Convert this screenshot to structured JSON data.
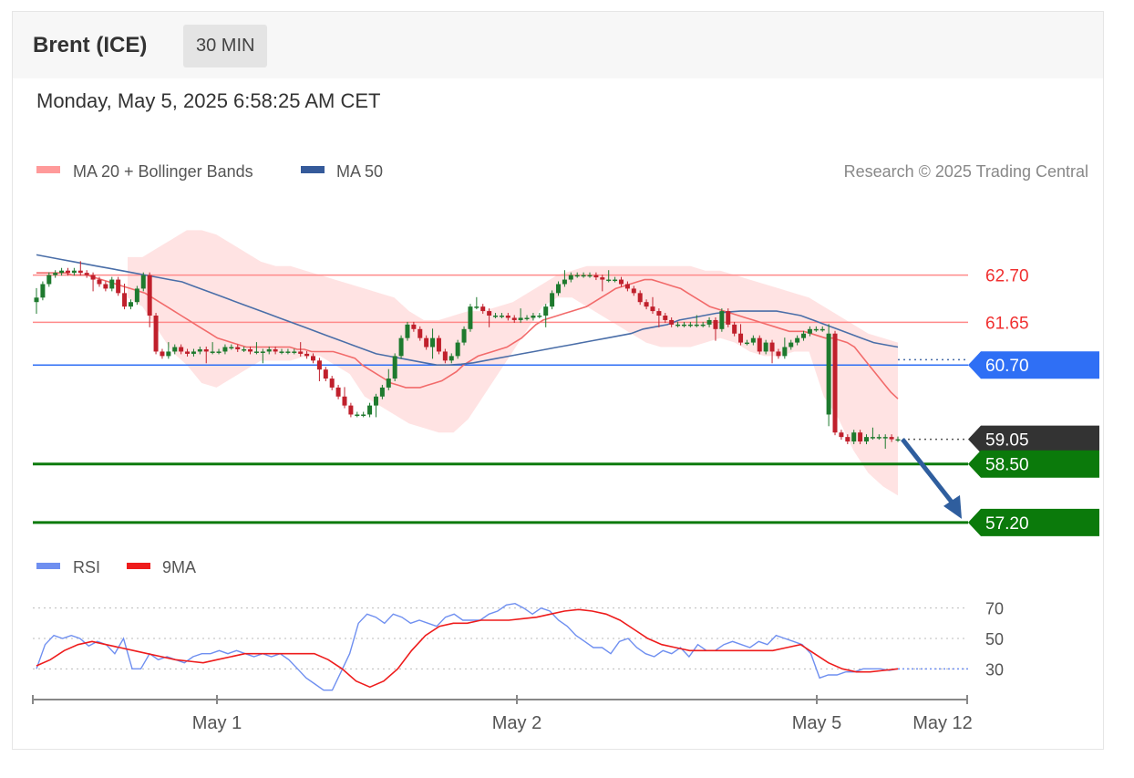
{
  "header": {
    "title": "Brent (ICE)",
    "interval": "30 MIN",
    "datetime": "Monday, May 5, 2025 6:58:25 AM CET"
  },
  "legend": {
    "ma20": "MA 20 + Bollinger Bands",
    "ma50": "MA 50",
    "rsi": "RSI",
    "rsi_ma": "9MA",
    "credit": "Research © 2025 Trading Central"
  },
  "colors": {
    "up": "#1e7a2e",
    "down": "#c0202c",
    "ma20": "#f26b6b",
    "ma50": "#4a6ea8",
    "band": "#ffd9d9",
    "resistance": "#ff4d4d",
    "pivot": "#2f6ff5",
    "support": "#0b7a0b",
    "last": "#333333",
    "arrow": "#2f5e9e"
  },
  "chart_data": [
    {
      "type": "candlestick",
      "x_labels": [
        "May 1",
        "May 2",
        "May 5",
        "May 12"
      ],
      "ylim": [
        56.75,
        63.95
      ],
      "levels": [
        {
          "value": 62.7,
          "label": "62.70",
          "kind": "resistance"
        },
        {
          "value": 61.65,
          "label": "61.65",
          "kind": "resistance"
        },
        {
          "value": 60.7,
          "label": "60.70",
          "kind": "pivot"
        },
        {
          "value": 59.05,
          "label": "59.05",
          "kind": "last"
        },
        {
          "value": 58.5,
          "label": "58.50",
          "kind": "support"
        },
        {
          "value": 57.2,
          "label": "57.20",
          "kind": "support"
        }
      ],
      "close": [
        62.2,
        62.5,
        62.7,
        62.75,
        62.8,
        62.75,
        62.8,
        62.75,
        62.7,
        62.6,
        62.5,
        62.4,
        62.6,
        62.3,
        62.0,
        62.1,
        62.4,
        62.7,
        61.8,
        61.0,
        60.9,
        61.0,
        61.1,
        61.0,
        60.95,
        61.0,
        61.05,
        61.0,
        61.0,
        61.0,
        61.1,
        61.1,
        61.05,
        61.05,
        61.0,
        61.0,
        61.0,
        61.05,
        61.0,
        61.0,
        61.0,
        61.0,
        60.95,
        60.9,
        60.8,
        60.6,
        60.4,
        60.2,
        60.0,
        59.8,
        59.6,
        59.6,
        59.6,
        59.8,
        60.0,
        60.2,
        60.4,
        60.9,
        61.3,
        61.6,
        61.5,
        61.3,
        61.1,
        61.3,
        61.0,
        60.8,
        60.9,
        61.2,
        61.5,
        62.0,
        62.0,
        61.9,
        61.8,
        61.8,
        61.8,
        61.75,
        61.7,
        61.75,
        61.75,
        61.8,
        61.8,
        62.0,
        62.3,
        62.5,
        62.6,
        62.7,
        62.7,
        62.7,
        62.7,
        62.65,
        62.6,
        62.6,
        62.6,
        62.5,
        62.4,
        62.3,
        62.1,
        62.0,
        61.9,
        61.8,
        61.7,
        61.6,
        61.6,
        61.6,
        61.6,
        61.6,
        61.6,
        61.7,
        61.5,
        61.9,
        61.6,
        61.4,
        61.2,
        61.2,
        61.3,
        61.0,
        61.2,
        61.0,
        60.9,
        61.1,
        61.2,
        61.3,
        61.4,
        61.5,
        61.5,
        61.5,
        61.4,
        59.2,
        59.1,
        59.0,
        59.2,
        59.0,
        59.1,
        59.1,
        59.1,
        59.1,
        59.05,
        59.05
      ],
      "ma20": [
        62.75,
        62.75,
        62.75,
        62.75,
        62.75,
        62.7,
        62.7,
        62.7,
        62.65,
        62.6,
        62.55,
        62.5,
        62.45,
        62.4,
        62.35,
        62.3,
        62.2,
        62.1,
        62.0,
        61.9,
        61.8,
        61.7,
        61.6,
        61.5,
        61.4,
        61.3,
        61.25,
        61.2,
        61.15,
        61.1,
        61.1,
        61.1,
        61.1,
        61.1,
        61.1,
        61.1,
        61.05,
        61.05,
        61.0,
        61.0,
        61.0,
        61.0,
        60.95,
        60.9,
        60.85,
        60.7,
        60.6,
        60.5,
        60.4,
        60.3,
        60.25,
        60.2,
        60.2,
        60.2,
        60.25,
        60.3,
        60.35,
        60.45,
        60.55,
        60.7,
        60.8,
        60.9,
        60.95,
        61.0,
        61.05,
        61.1,
        61.2,
        61.3,
        61.45,
        61.6,
        61.7,
        61.75,
        61.8,
        61.85,
        61.9,
        61.95,
        62.0,
        62.1,
        62.2,
        62.3,
        62.4,
        62.45,
        62.5,
        62.55,
        62.6,
        62.6,
        62.55,
        62.5,
        62.45,
        62.4,
        62.3,
        62.2,
        62.1,
        62.0,
        61.95,
        61.9,
        61.85,
        61.8,
        61.75,
        61.7,
        61.65,
        61.6,
        61.55,
        61.5,
        61.45,
        61.45,
        61.45,
        61.4,
        61.35,
        61.3,
        61.3,
        61.25,
        61.2,
        61.1,
        60.9,
        60.7,
        60.5,
        60.3,
        60.1,
        59.95
      ],
      "ma50": [
        63.15,
        63.1,
        63.05,
        63.0,
        62.95,
        62.9,
        62.85,
        62.8,
        62.75,
        62.7,
        62.65,
        62.6,
        62.55,
        62.45,
        62.35,
        62.25,
        62.15,
        62.05,
        61.95,
        61.85,
        61.75,
        61.65,
        61.55,
        61.45,
        61.35,
        61.25,
        61.15,
        61.05,
        60.95,
        60.9,
        60.85,
        60.8,
        60.75,
        60.7,
        60.7,
        60.72,
        60.75,
        60.8,
        60.85,
        60.9,
        60.95,
        61.0,
        61.05,
        61.1,
        61.15,
        61.2,
        61.25,
        61.3,
        61.35,
        61.4,
        61.5,
        61.55,
        61.6,
        61.7,
        61.75,
        61.8,
        61.85,
        61.88,
        61.9,
        61.9,
        61.9,
        61.9,
        61.85,
        61.8,
        61.7,
        61.6,
        61.5,
        61.4,
        61.3,
        61.2,
        61.15,
        61.1
      ],
      "band_upper": [
        63.1,
        63.1,
        63.3,
        63.5,
        63.7,
        63.7,
        63.6,
        63.4,
        63.2,
        63.0,
        62.9,
        62.9,
        62.8,
        62.7,
        62.6,
        62.5,
        62.4,
        62.3,
        62.2,
        61.9,
        61.7,
        61.7,
        61.8,
        61.9,
        61.9,
        62.0,
        62.1,
        62.3,
        62.5,
        62.7,
        62.8,
        62.9,
        62.9,
        62.9,
        62.9,
        62.9,
        62.9,
        62.9,
        62.9,
        62.8,
        62.8,
        62.7,
        62.6,
        62.5,
        62.4,
        62.3,
        62.2,
        62.0,
        61.8,
        61.6,
        61.4,
        61.3,
        61.2,
        61.2,
        62.6,
        62.4,
        62.2,
        62.0,
        61.7,
        61.4
      ],
      "band_lower": [
        62.2,
        62.0,
        61.5,
        61.0,
        60.7,
        60.3,
        60.2,
        60.4,
        60.6,
        60.8,
        60.8,
        60.8,
        60.9,
        60.9,
        60.7,
        60.5,
        60.0,
        59.8,
        59.6,
        59.4,
        59.3,
        59.2,
        59.2,
        59.5,
        60.0,
        60.5,
        61.0,
        61.5,
        62.0,
        62.2,
        62.2,
        62.0,
        61.8,
        61.6,
        61.4,
        61.2,
        61.1,
        61.1,
        61.1,
        61.2,
        61.3,
        61.2,
        61.0,
        60.9,
        60.9,
        61.0,
        61.0,
        60.0,
        59.5,
        58.8,
        58.3,
        58.0,
        57.8
      ],
      "forecast": {
        "from": 59.05,
        "to": 57.2
      }
    },
    {
      "type": "line",
      "x_labels": [
        "May 1",
        "May 2",
        "May 5",
        "May 12"
      ],
      "ylim": [
        14,
        83
      ],
      "yticks": [
        70,
        50,
        30
      ],
      "series": [
        {
          "name": "RSI",
          "values": [
            30,
            46,
            52,
            50,
            52,
            50,
            45,
            48,
            46,
            40,
            50,
            30,
            30,
            40,
            36,
            38,
            36,
            34,
            38,
            40,
            40,
            42,
            40,
            42,
            40,
            38,
            40,
            38,
            40,
            36,
            30,
            24,
            20,
            16,
            16,
            28,
            40,
            60,
            66,
            64,
            60,
            66,
            64,
            60,
            62,
            60,
            58,
            64,
            66,
            62,
            62,
            62,
            66,
            68,
            72,
            73,
            70,
            66,
            70,
            68,
            62,
            58,
            52,
            48,
            44,
            44,
            40,
            48,
            50,
            44,
            40,
            38,
            42,
            40,
            44,
            38,
            46,
            42,
            42,
            46,
            48,
            46,
            44,
            48,
            46,
            52,
            50,
            48,
            46,
            40,
            24,
            26,
            26,
            28,
            28,
            30,
            30,
            30,
            29,
            30
          ]
        },
        {
          "name": "9MA",
          "values": [
            32,
            36,
            42,
            46,
            48,
            46,
            44,
            42,
            40,
            38,
            36,
            35,
            34,
            36,
            38,
            40,
            40,
            40,
            40,
            40,
            40,
            36,
            30,
            22,
            18,
            22,
            30,
            42,
            52,
            58,
            60,
            60,
            62,
            62,
            62,
            63,
            64,
            66,
            68,
            69,
            68,
            66,
            62,
            56,
            50,
            46,
            44,
            42,
            42,
            42,
            42,
            42,
            42,
            42,
            44,
            46,
            40,
            34,
            30,
            28,
            28,
            29,
            30
          ]
        }
      ]
    }
  ]
}
